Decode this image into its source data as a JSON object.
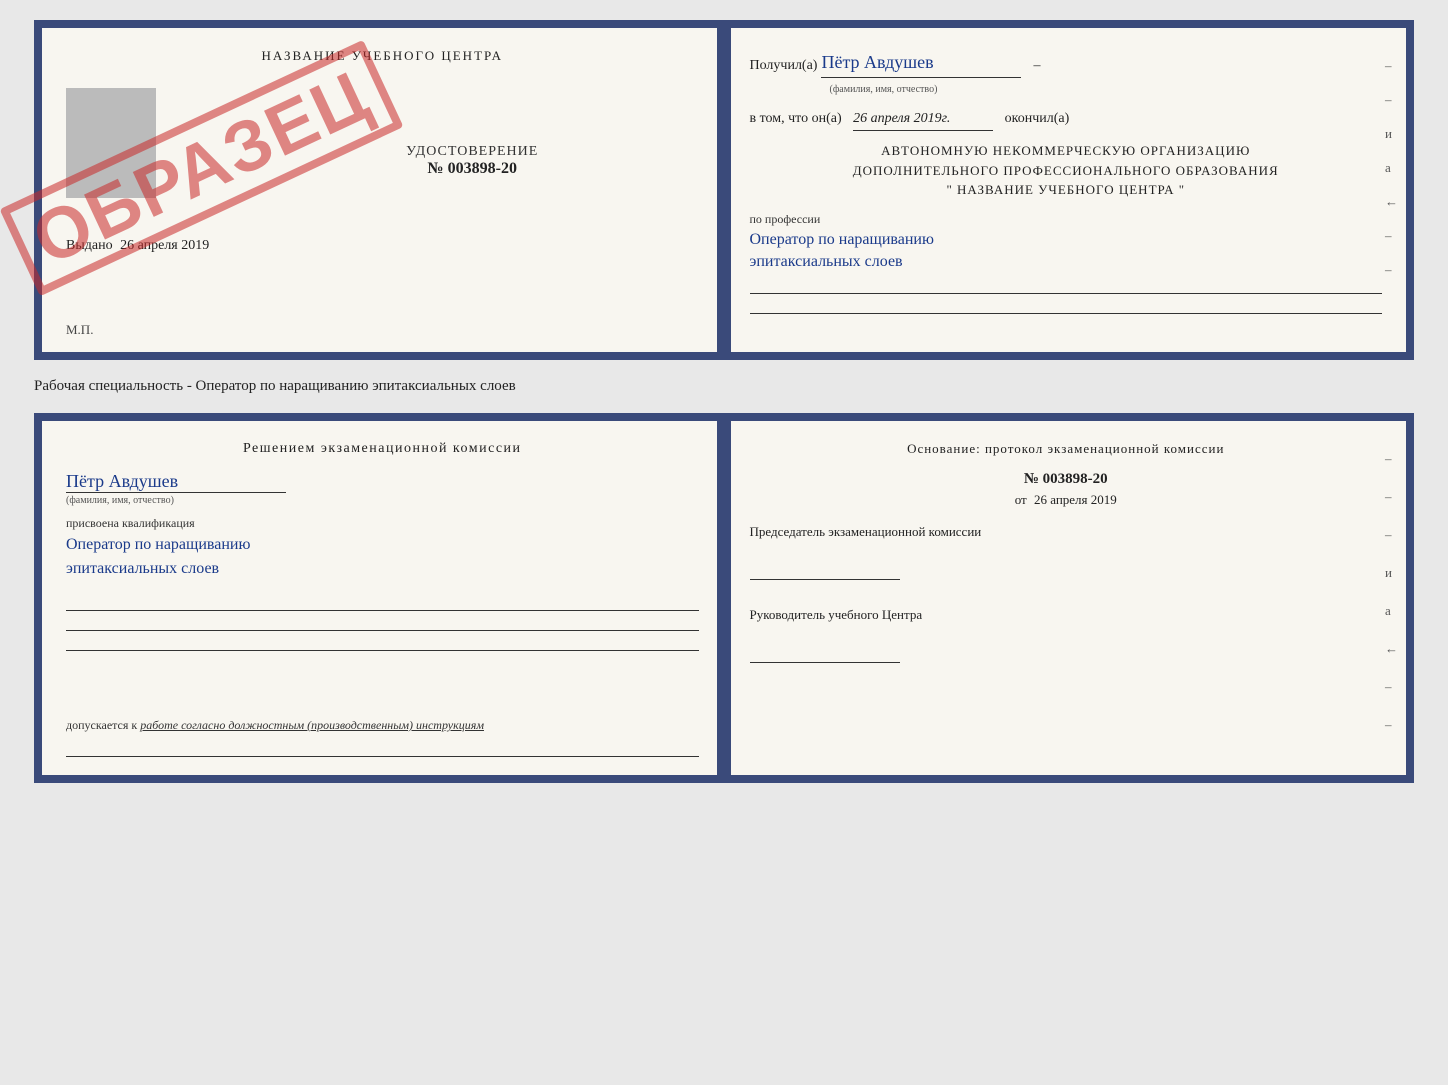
{
  "page": {
    "background": "#e8e8e8"
  },
  "cert1": {
    "left": {
      "title": "НАЗВАНИЕ УЧЕБНОГО ЦЕНТРА",
      "udost_label": "УДОСТОВЕРЕНИЕ",
      "udost_number": "№ 003898-20",
      "vydano": "Выдано",
      "vydano_date": "26 апреля 2019",
      "mp": "М.П.",
      "stamp": "ОБРАЗЕЦ"
    },
    "right": {
      "poluchil": "Получил(а)",
      "name": "Пётр Авдушев",
      "fio_hint": "(фамилия, имя, отчество)",
      "dash": "–",
      "vtom": "в том, что он(а)",
      "date": "26 апреля 2019г.",
      "okonchil": "окончил(а)",
      "org_line1": "АВТОНОМНУЮ НЕКОММЕРЧЕСКУЮ ОРГАНИЗАЦИЮ",
      "org_line2": "ДОПОЛНИТЕЛЬНОГО ПРОФЕССИОНАЛЬНОГО ОБРАЗОВАНИЯ",
      "org_line3": "\"   НАЗВАНИЕ УЧЕБНОГО ЦЕНТРА   \"",
      "po_professii": "по профессии",
      "profession1": "Оператор по наращиванию",
      "profession2": "эпитаксиальных слоев",
      "dashes": [
        "–",
        "–",
        "и",
        "а",
        "←",
        "–",
        "–"
      ]
    }
  },
  "caption": {
    "text": "Рабочая специальность - Оператор по наращиванию эпитаксиальных слоев"
  },
  "cert2": {
    "left": {
      "resheniem": "Решением  экзаменационной  комиссии",
      "name": "Пётр Авдушев",
      "fio_hint": "(фамилия, имя, отчество)",
      "prisvoena": "присвоена квалификация",
      "profession1": "Оператор по наращиванию",
      "profession2": "эпитаксиальных слоев",
      "dopuskaetsya": "допускается к",
      "dopusk_text": "работе согласно должностным (производственным) инструкциям"
    },
    "right": {
      "osnovanie": "Основание: протокол экзаменационной  комиссии",
      "number": "№  003898-20",
      "ot": "от",
      "date": "26 апреля 2019",
      "predsedatel_label": "Председатель экзаменационной комиссии",
      "rukovoditel_label": "Руководитель учебного Центра",
      "dashes": [
        "–",
        "–",
        "–",
        "и",
        "а",
        "←",
        "–",
        "–"
      ]
    }
  }
}
